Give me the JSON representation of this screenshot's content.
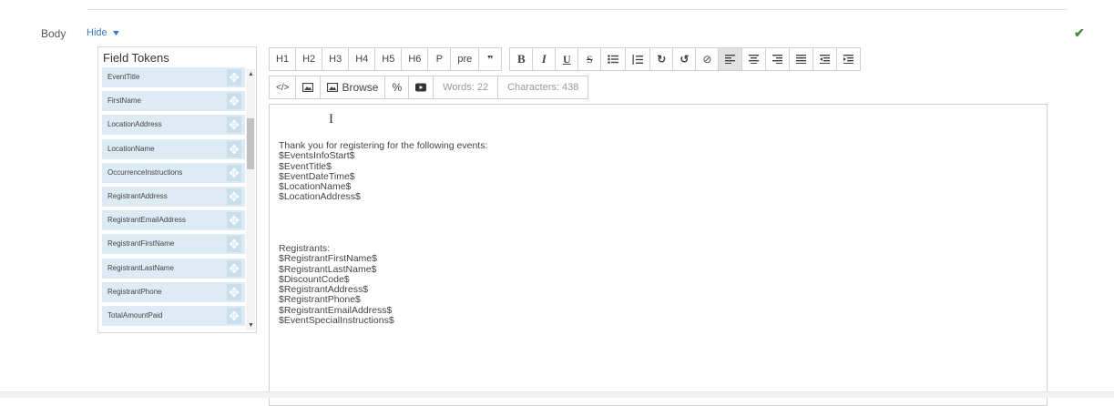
{
  "field": {
    "label": "Body",
    "hide_label": "Hide"
  },
  "tokens": {
    "title": "Field Tokens",
    "items": [
      "EventTitle",
      "FirstName",
      "LocationAddress",
      "LocationName",
      "OccurrenceInstructions",
      "RegistrantAddress",
      "RegistrantEmailAddress",
      "RegistrantFirstName",
      "RegistrantLastName",
      "RegistrantPhone",
      "TotalAmountPaid"
    ]
  },
  "toolbar": {
    "headings": [
      "H1",
      "H2",
      "H3",
      "H4",
      "H5",
      "H6",
      "P",
      "pre"
    ],
    "quote": "❞",
    "bold": "B",
    "italic": "I",
    "underline": "U",
    "strike": "S",
    "browse_label": "Browse",
    "words": "Words: 22",
    "characters": "Characters: 438"
  },
  "editor": {
    "lines": [
      "Thank you for registering for the following events:",
      "$EventsInfoStart$",
      "$EventTitle$",
      "$EventDateTime$",
      "$LocationName$",
      "$LocationAddress$",
      "",
      "",
      "",
      "",
      "Registrants:",
      "$RegistrantFirstName$",
      "$RegistrantLastName$",
      "$DiscountCode$",
      "$RegistrantAddress$",
      "$RegistrantPhone$",
      "$RegistrantEmailAddress$",
      "$EventSpecialInstructions$"
    ]
  },
  "colors": {
    "link": "#3a7bbf",
    "check": "#4a8a3a",
    "token_bg": "#dcebf4"
  }
}
